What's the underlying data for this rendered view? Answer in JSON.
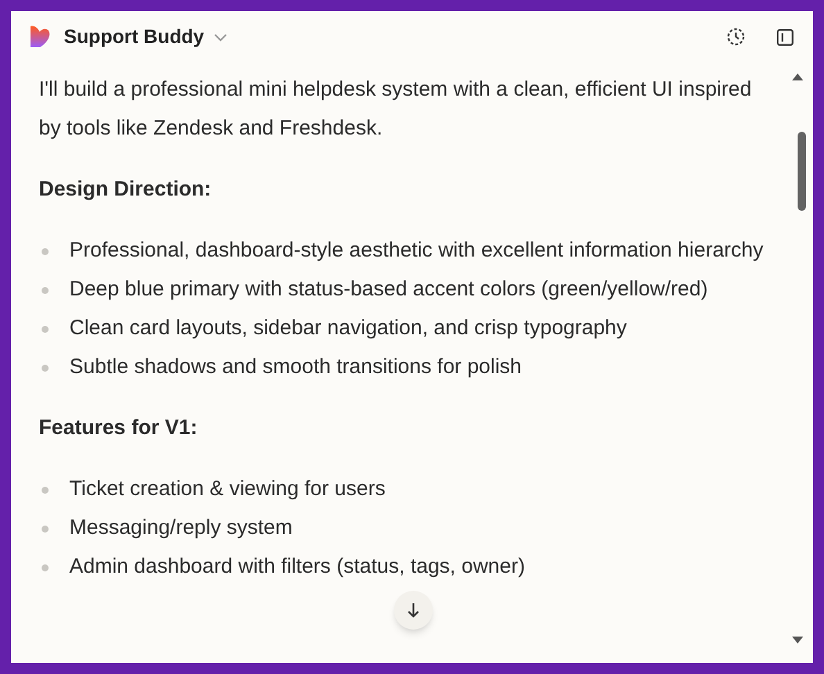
{
  "header": {
    "title": "Support Buddy"
  },
  "content": [
    {
      "kind": "paragraph",
      "text": "I'll build a professional mini helpdesk system with a clean, efficient UI inspired by tools like Zendesk and Freshdesk."
    },
    {
      "kind": "heading",
      "text": "Design Direction:"
    },
    {
      "kind": "list",
      "items": [
        "Professional, dashboard-style aesthetic with excellent information hierarchy",
        "Deep blue primary with status-based accent colors (green/yellow/red)",
        "Clean card layouts, sidebar navigation, and crisp typography",
        "Subtle shadows and smooth transitions for polish"
      ]
    },
    {
      "kind": "heading",
      "text": "Features for V1:"
    },
    {
      "kind": "list",
      "items": [
        "Ticket creation & viewing for users",
        "Messaging/reply system",
        "Admin dashboard with filters (status, tags, owner)"
      ]
    }
  ]
}
